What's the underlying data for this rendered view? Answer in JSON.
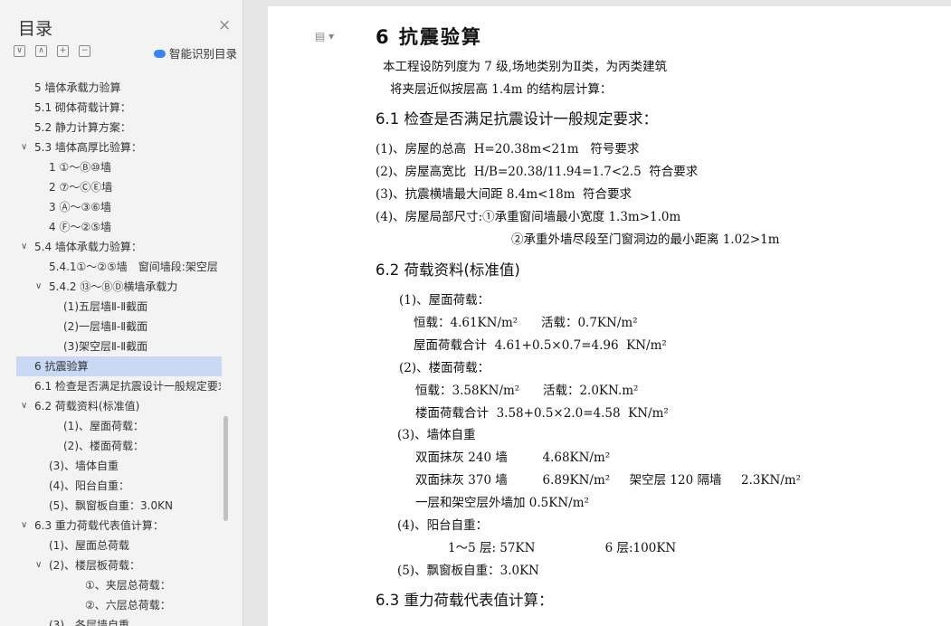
{
  "sidebar": {
    "title": "目录",
    "smart_toc_label": "智能识别目录",
    "items": [
      {
        "label": "5 墙体承载力验算",
        "chevron": ""
      },
      {
        "label": "5.1 砌体荷载计算：",
        "chevron": ""
      },
      {
        "label": "5.2 静力计算方案：",
        "chevron": ""
      },
      {
        "label": "5.3 墙体高厚比验算：",
        "chevron": "∨"
      },
      {
        "label": "1 ①～Ⓑ⑩墙",
        "chevron": ""
      },
      {
        "label": "2 ⑦～ⒸⒺ墙",
        "chevron": ""
      },
      {
        "label": "3 Ⓐ～③⑥墙",
        "chevron": ""
      },
      {
        "label": "4 Ⓕ～②⑤墙",
        "chevron": ""
      },
      {
        "label": "5.4 墙体承载力验算：",
        "chevron": "∨"
      },
      {
        "label": "5.4.1①～②⑤墙　窗间墙段:架空层墙...",
        "chevron": ""
      },
      {
        "label": "5.4.2 ⑬～ⒷⒹ横墙承载力",
        "chevron": "∨"
      },
      {
        "label": "(1)五层墙Ⅱ-Ⅱ截面",
        "chevron": ""
      },
      {
        "label": "(2)一层墙Ⅱ-Ⅱ截面",
        "chevron": ""
      },
      {
        "label": "(3)架空层Ⅱ-Ⅱ截面",
        "chevron": ""
      },
      {
        "label": "6 抗震验算",
        "chevron": ""
      },
      {
        "label": "6.1 检查是否满足抗震设计一般规定要求：",
        "chevron": ""
      },
      {
        "label": "6.2 荷载资料(标准值)",
        "chevron": "∨"
      },
      {
        "label": "(1)、屋面荷载：",
        "chevron": ""
      },
      {
        "label": "(2)、楼面荷载：",
        "chevron": ""
      },
      {
        "label": "(3)、墙体自重",
        "chevron": ""
      },
      {
        "label": "(4)、阳台自重：",
        "chevron": ""
      },
      {
        "label": "(5)、飘窗板自重：3.0KN",
        "chevron": ""
      },
      {
        "label": "6.3 重力荷载代表值计算：",
        "chevron": "∨"
      },
      {
        "label": "(1)、屋面总荷载",
        "chevron": ""
      },
      {
        "label": "(2)、楼层板荷载：",
        "chevron": "∨"
      },
      {
        "label": "①、夹层总荷载：",
        "chevron": ""
      },
      {
        "label": "②、六层总荷载：",
        "chevron": ""
      },
      {
        "label": "(3)、各层墙自重",
        "chevron": ""
      }
    ]
  },
  "document": {
    "lines": [
      "6 抗震验算",
      "本工程设防列度为 7 级,场地类别为Ⅱ类，为丙类建筑",
      "将夹层近似按层高 1.4m 的结构层计算：",
      "6.1 检查是否满足抗震设计一般规定要求：",
      "(1)、房屋的总高  H=20.38m<21m   符号要求",
      "(2)、房屋高宽比  H/B=20.38/11.94=1.7<2.5  符合要求",
      "(3)、抗震横墙最大间距 8.4m<18m  符合要求",
      "(4)、房屋局部尺寸:①承重窗间墙最小宽度 1.3m>1.0m",
      "②承重外墙尽段至门窗洞边的最小距离 1.02>1m",
      "6.2 荷载资料(标准值)",
      "(1)、屋面荷载：",
      "恒载：4.61KN/m²      活载：0.7KN/m²",
      "屋面荷载合计  4.61+0.5×0.7=4.96  KN/m²",
      "(2)、楼面荷载：",
      "恒载：3.58KN/m²      活载：2.0KN.m²",
      "楼面荷载合计  3.58+0.5×2.0=4.58  KN/m²",
      "(3)、墙体自重",
      "双面抹灰 240 墙         4.68KN/m²",
      "双面抹灰 370 墙         6.89KN/m²     架空层 120 隔墙     2.3KN/m²",
      "一层和架空层外墙加 0.5KN/m²",
      "(4)、阳台自重：",
      "1～5 层: 57KN                  6 层:100KN",
      "(5)、飘窗板自重：3.0KN",
      "6.3 重力荷载代表值计算："
    ]
  }
}
